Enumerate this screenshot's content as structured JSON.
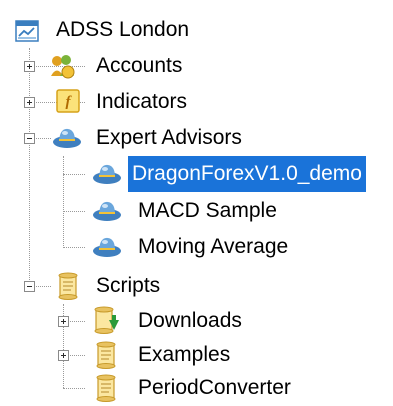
{
  "tree": {
    "root": {
      "label": "ADSS London",
      "icon": "server-icon"
    },
    "accounts": {
      "label": "Accounts",
      "icon": "accounts-icon",
      "state": "collapsed"
    },
    "indicators": {
      "label": "Indicators",
      "icon": "indicator-f-icon",
      "state": "collapsed"
    },
    "expert_advisors": {
      "label": "Expert Advisors",
      "icon": "expert-advisor-hat-icon",
      "state": "expanded",
      "items": [
        {
          "label": "DragonForexV1.0_demo",
          "icon": "expert-advisor-hat-icon",
          "selected": true
        },
        {
          "label": "MACD Sample",
          "icon": "expert-advisor-hat-icon"
        },
        {
          "label": "Moving Average",
          "icon": "expert-advisor-hat-icon"
        }
      ]
    },
    "scripts": {
      "label": "Scripts",
      "icon": "script-scroll-icon",
      "state": "expanded",
      "items": [
        {
          "label": "Downloads",
          "icon": "script-download-icon",
          "state": "collapsed"
        },
        {
          "label": "Examples",
          "icon": "script-scroll-icon",
          "state": "collapsed"
        },
        {
          "label": "PeriodConverter",
          "icon": "script-scroll-icon"
        }
      ]
    }
  },
  "colors": {
    "selection": "#1a73d9",
    "selection_text": "#ffffff",
    "tree_lines": "#9a9a9a"
  }
}
